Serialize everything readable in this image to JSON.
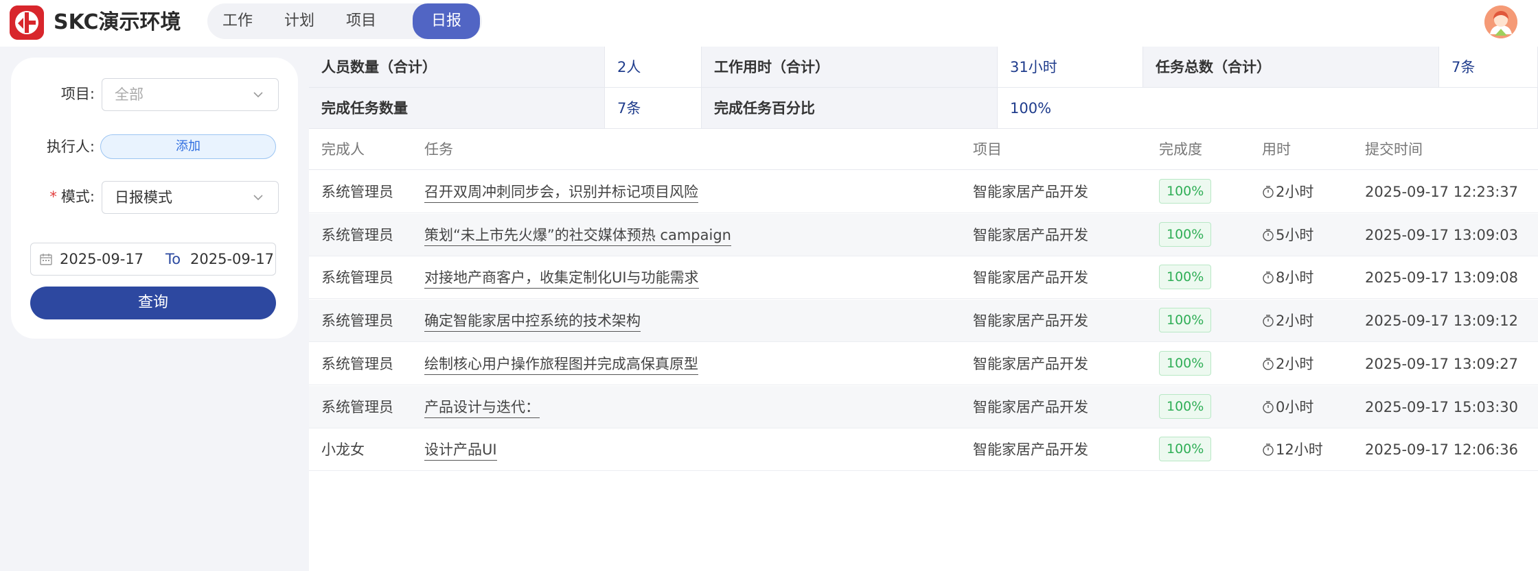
{
  "app": {
    "title": "SKC演示环境"
  },
  "nav": {
    "tabs": [
      {
        "label": "工作"
      },
      {
        "label": "计划"
      },
      {
        "label": "项目"
      },
      {
        "label": "日报"
      }
    ],
    "active": "日报"
  },
  "filter": {
    "project_label": "项目:",
    "project_placeholder": "全部",
    "assignee_label": "执行人:",
    "add_label": "添加",
    "mode_label": "模式:",
    "mode_value": "日报模式",
    "date_from": "2025-09-17",
    "date_to_word": "To",
    "date_to": "2025-09-17",
    "query_label": "查询"
  },
  "summary": {
    "people_label": "人员数量（合计）",
    "people_value": "2人",
    "hours_label": "工作用时（合计）",
    "hours_value": "31小时",
    "tasks_label": "任务总数（合计）",
    "tasks_value": "7条",
    "done_label": "完成任务数量",
    "done_value": "7条",
    "pct_label": "完成任务百分比",
    "pct_value": "100%"
  },
  "table": {
    "columns": [
      "完成人",
      "任务",
      "项目",
      "完成度",
      "用时",
      "提交时间"
    ],
    "rows": [
      {
        "person": "系统管理员",
        "task": "召开双周冲刺同步会，识别并标记项目风险",
        "project": "智能家居产品开发",
        "progress": "100%",
        "duration": "2小时",
        "submitted": "2025-09-17 12:23:37"
      },
      {
        "person": "系统管理员",
        "task": "策划“未上市先火爆”的社交媒体预热 campaign",
        "project": "智能家居产品开发",
        "progress": "100%",
        "duration": "5小时",
        "submitted": "2025-09-17 13:09:03"
      },
      {
        "person": "系统管理员",
        "task": "对接地产商客户，收集定制化UI与功能需求",
        "project": "智能家居产品开发",
        "progress": "100%",
        "duration": "8小时",
        "submitted": "2025-09-17 13:09:08"
      },
      {
        "person": "系统管理员",
        "task": "确定智能家居中控系统的技术架构",
        "project": "智能家居产品开发",
        "progress": "100%",
        "duration": "2小时",
        "submitted": "2025-09-17 13:09:12"
      },
      {
        "person": "系统管理员",
        "task": "绘制核心用户操作旅程图并完成高保真原型",
        "project": "智能家居产品开发",
        "progress": "100%",
        "duration": "2小时",
        "submitted": "2025-09-17 13:09:27"
      },
      {
        "person": "系统管理员",
        "task": "产品设计与迭代：",
        "project": "智能家居产品开发",
        "progress": "100%",
        "duration": "0小时",
        "submitted": "2025-09-17 15:03:30"
      },
      {
        "person": "小龙女",
        "task": "设计产品UI",
        "project": "智能家居产品开发",
        "progress": "100%",
        "duration": "12小时",
        "submitted": "2025-09-17 12:06:36"
      }
    ]
  },
  "colors": {
    "brand_red": "#d8262c",
    "nav_active": "#5165c4",
    "primary_button": "#2d48a0",
    "badge_green": "#2fae56"
  },
  "icons": [
    "app-logo-icon",
    "chevron-down-icon",
    "calendar-icon",
    "stopwatch-icon",
    "avatar-icon"
  ]
}
